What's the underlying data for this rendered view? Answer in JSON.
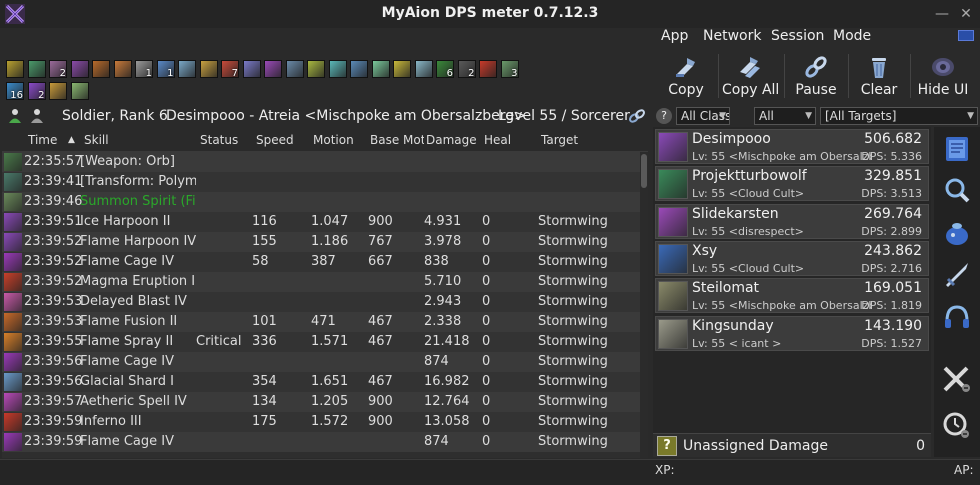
{
  "window": {
    "title": "MyAion DPS meter 0.7.12.3",
    "minimize": "—",
    "close": "✕"
  },
  "menu": {
    "app": "App",
    "network": "Network",
    "session": "Session",
    "mode": "Mode"
  },
  "skill_strip": {
    "colors": [
      "#b8a030",
      "#4a9a6a",
      "#9a6a9a",
      "#8a4aa8",
      "#b86a2a",
      "#c87a3a",
      "#9a9a9a",
      "#5a8ac8",
      "#7aa8c8",
      "#c8a040",
      "#c84a3a",
      "#7a7ac8",
      "#9a4ab8",
      "#6a8aa8",
      "#a8b840",
      "#5ab8b8",
      "#5a8ab8",
      "#7ac89a",
      "#c8b83a",
      "#8ab8c8",
      "#3a8a3a",
      "#5a5a5a",
      "#c83a2a",
      "#6a9a6a",
      "#3a8ac8",
      "#8a4ac8",
      "#c89a3a",
      "#8ab870"
    ],
    "badges": [
      "",
      "",
      "2",
      "",
      "",
      "",
      "1",
      "1",
      "",
      "",
      "7",
      "",
      "",
      "",
      "",
      "",
      "",
      "",
      "",
      "",
      "6",
      "2",
      "",
      "3",
      "16",
      "2",
      ""
    ],
    "more": "1"
  },
  "toolbar": {
    "copy": "Copy",
    "copy_all": "Copy All",
    "pause": "Pause",
    "clear": "Clear",
    "hide_ui": "Hide UI"
  },
  "character": {
    "rank": "Soldier, Rank 6",
    "name_server": "Desimpooo - Atreia <Mischpoke am Obersalzberg>",
    "level": "Level 55 / Sorcerer"
  },
  "filters": {
    "classes": "All Classes",
    "type": "All",
    "targets": "[All Targets]",
    "help": "?"
  },
  "log": {
    "headers": {
      "time": "Time",
      "skill": "Skill",
      "status": "Status",
      "speed": "Speed",
      "motion": "Motion",
      "base_motion": "Base Motion",
      "damage": "Damage",
      "heal": "Heal",
      "target": "Target"
    },
    "rows": [
      {
        "time": "22:35:57",
        "skill": "[Weapon: Orb]",
        "status": "",
        "speed": "",
        "motion": "",
        "base": "",
        "damage": "",
        "heal": "",
        "target": "",
        "color": "#4a7a4a",
        "green": false
      },
      {
        "time": "23:39:41",
        "skill": "[Transform: Polymor",
        "status": "",
        "speed": "",
        "motion": "",
        "base": "",
        "damage": "",
        "heal": "",
        "target": "",
        "color": "#4a7a6a",
        "green": false
      },
      {
        "time": "23:39:46",
        "skill": "Summon Spirit (Fi)",
        "status": "",
        "speed": "",
        "motion": "",
        "base": "",
        "damage": "",
        "heal": "",
        "target": "",
        "color": "#6a8a5a",
        "green": true
      },
      {
        "time": "23:39:51",
        "skill": "Ice Harpoon II",
        "status": "",
        "speed": "116",
        "motion": "1.047",
        "base": "900",
        "damage": "4.931",
        "heal": "0",
        "target": "Stormwing",
        "color": "#8a4ab8",
        "green": false
      },
      {
        "time": "23:39:52",
        "skill": "Flame Harpoon IV",
        "status": "",
        "speed": "155",
        "motion": "1.186",
        "base": "767",
        "damage": "3.978",
        "heal": "0",
        "target": "Stormwing",
        "color": "#8a4ab8",
        "green": false
      },
      {
        "time": "23:39:52",
        "skill": "Flame Cage IV",
        "status": "",
        "speed": "58",
        "motion": "387",
        "base": "667",
        "damage": "838",
        "heal": "0",
        "target": "Stormwing",
        "color": "#9a3ab8",
        "green": false
      },
      {
        "time": "23:39:52",
        "skill": "Magma Eruption I",
        "status": "",
        "speed": "",
        "motion": "",
        "base": "",
        "damage": "5.710",
        "heal": "0",
        "target": "Stormwing",
        "color": "#c8402a",
        "green": false
      },
      {
        "time": "23:39:53",
        "skill": "Delayed Blast IV",
        "status": "",
        "speed": "",
        "motion": "",
        "base": "",
        "damage": "2.943",
        "heal": "0",
        "target": "Stormwing",
        "color": "#c85aa8",
        "green": false
      },
      {
        "time": "23:39:53",
        "skill": "Flame Fusion II",
        "status": "",
        "speed": "101",
        "motion": "471",
        "base": "467",
        "damage": "2.338",
        "heal": "0",
        "target": "Stormwing",
        "color": "#c86a2a",
        "green": false
      },
      {
        "time": "23:39:55",
        "skill": "Flame Spray II",
        "status": "Critical",
        "speed": "336",
        "motion": "1.571",
        "base": "467",
        "damage": "21.418",
        "heal": "0",
        "target": "Stormwing",
        "color": "#d8802a",
        "green": false
      },
      {
        "time": "23:39:56",
        "skill": "Flame Cage IV",
        "status": "",
        "speed": "",
        "motion": "",
        "base": "",
        "damage": "874",
        "heal": "0",
        "target": "Stormwing",
        "color": "#9a3ab8",
        "green": false
      },
      {
        "time": "23:39:56",
        "skill": "Glacial Shard I",
        "status": "",
        "speed": "354",
        "motion": "1.651",
        "base": "467",
        "damage": "16.982",
        "heal": "0",
        "target": "Stormwing",
        "color": "#6a9ac8",
        "green": false
      },
      {
        "time": "23:39:57",
        "skill": "Aetheric Spell IV",
        "status": "",
        "speed": "134",
        "motion": "1.205",
        "base": "900",
        "damage": "12.764",
        "heal": "0",
        "target": "Stormwing",
        "color": "#b84ab8",
        "green": false
      },
      {
        "time": "23:39:59",
        "skill": "Inferno III",
        "status": "",
        "speed": "175",
        "motion": "1.572",
        "base": "900",
        "damage": "13.058",
        "heal": "0",
        "target": "Stormwing",
        "color": "#c83a2a",
        "green": false
      },
      {
        "time": "23:39:59",
        "skill": "Flame Cage IV",
        "status": "",
        "speed": "",
        "motion": "",
        "base": "",
        "damage": "874",
        "heal": "0",
        "target": "Stormwing",
        "color": "#9a3ab8",
        "green": false
      }
    ]
  },
  "players": [
    {
      "name": "Desimpooo",
      "level": "Lv: 55",
      "legion": "<Mischpoke am Obersalzberg",
      "total": "506.682",
      "dps": "DPS: 5.336",
      "color": "#8a4ab8"
    },
    {
      "name": "Projektturbowolf",
      "level": "Lv: 55",
      "legion": "<Cloud Cult>",
      "total": "329.851",
      "dps": "DPS: 3.513",
      "color": "#3a8a5a"
    },
    {
      "name": "Slidekarsten",
      "level": "Lv: 55",
      "legion": "<disrespect>",
      "total": "269.764",
      "dps": "DPS: 2.899",
      "color": "#9a4ab8"
    },
    {
      "name": "Xsy",
      "level": "Lv: 55",
      "legion": "<Cloud Cult>",
      "total": "243.862",
      "dps": "DPS: 2.716",
      "color": "#3a6ab8"
    },
    {
      "name": "Steilomat",
      "level": "Lv: 55",
      "legion": "<Mischpoke am Obersalzberg",
      "total": "169.051",
      "dps": "DPS: 1.819",
      "color": "#8a8a6a"
    },
    {
      "name": "Kingsunday",
      "level": "Lv: 55",
      "legion": "< icant >",
      "total": "143.190",
      "dps": "DPS: 1.527",
      "color": "#9a9a8a"
    }
  ],
  "unassigned": {
    "label": "Unassigned Damage",
    "value": "0",
    "icon": "?"
  },
  "status": {
    "xp": "XP:",
    "ap": "AP:"
  }
}
